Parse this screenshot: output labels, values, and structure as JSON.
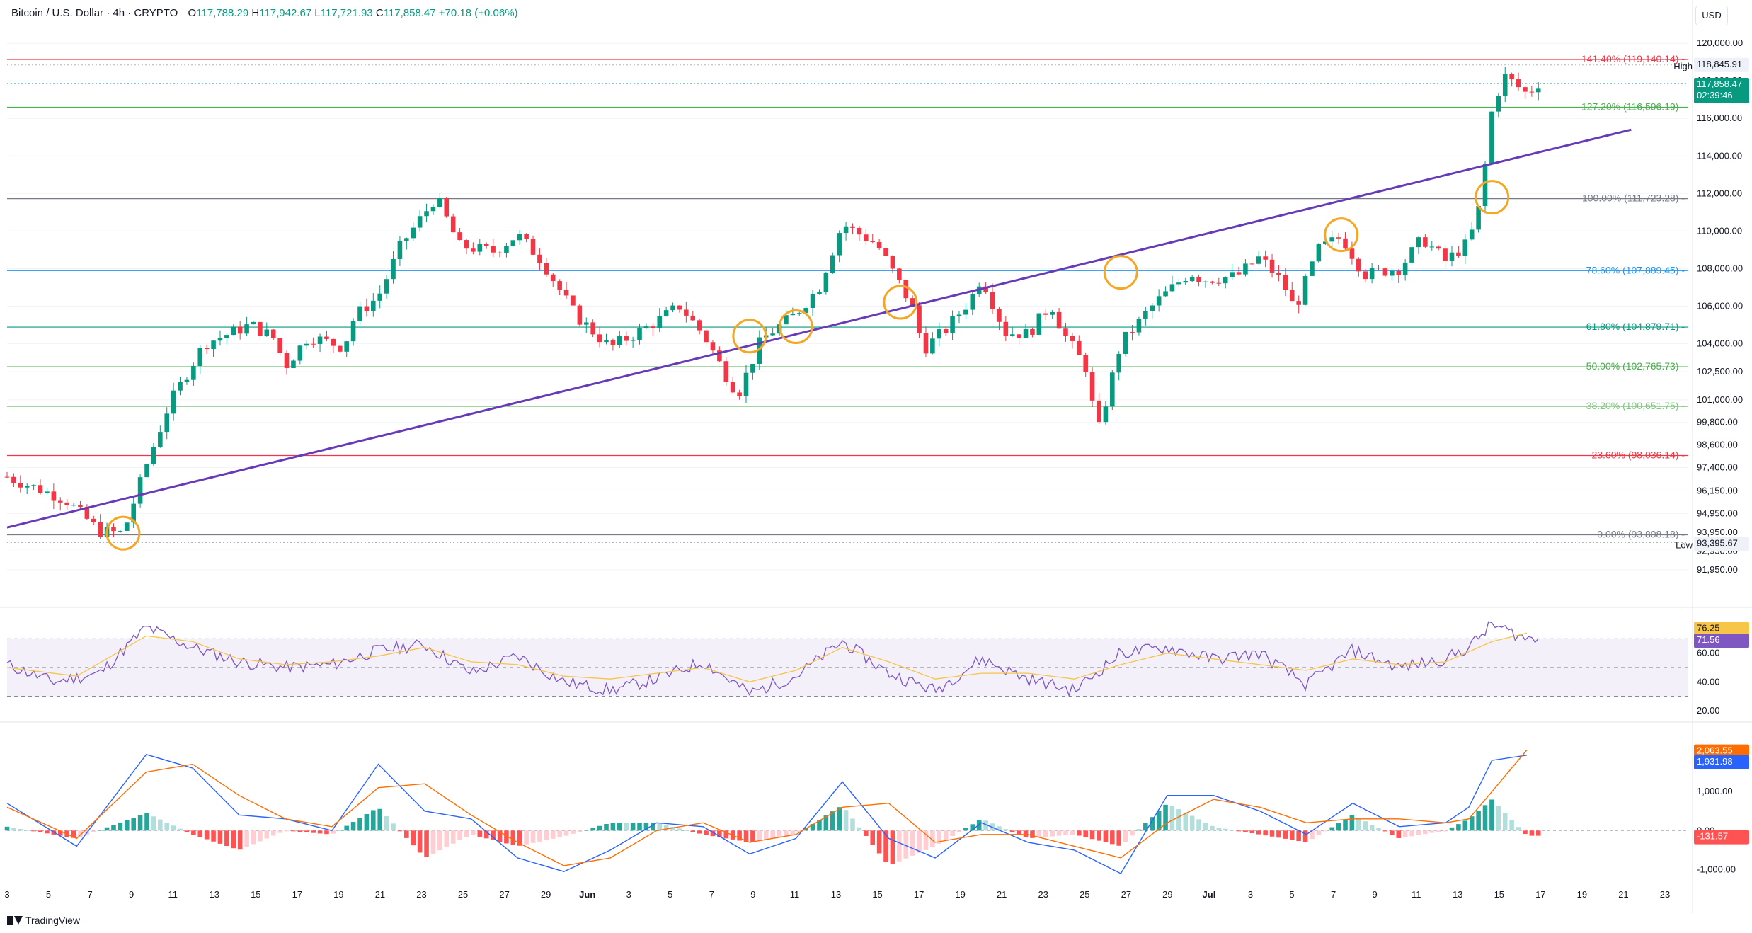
{
  "header": {
    "symbol": "Bitcoin / U.S. Dollar · 4h · CRYPTO",
    "o_label": "O",
    "o": "117,788.29",
    "h_label": "H",
    "h": "117,942.67",
    "l_label": "L",
    "l": "117,721.93",
    "c_label": "C",
    "c": "117,858.47",
    "change": "+70.18 (+0.06%)"
  },
  "currency_button": "USD",
  "brand": "TradingView",
  "colors": {
    "up": "#089981",
    "down": "#f23645",
    "trendline": "#673ab7",
    "circle": "#f5a623",
    "rsi": "#7e57c2",
    "rsi_ma": "#f7c548",
    "macd": "#2962ff",
    "signal": "#ff6d00"
  },
  "chart_data": [
    {
      "type": "candlestick",
      "timeframe": "4h",
      "yaxis_labels": [
        "120,000.00",
        "118,000.00",
        "116,000.00",
        "114,000.00",
        "112,000.00",
        "110,000.00",
        "108,000.00",
        "106,000.00",
        "104,000.00",
        "102,500.00",
        "101,000.00",
        "99,800.00",
        "98,600.00",
        "97,400.00",
        "96,150.00",
        "94,950.00",
        "93,950.00",
        "92,950.00",
        "91,950.00"
      ],
      "ylim": [
        91000,
        120800
      ],
      "xaxis_labels": [
        "3",
        "5",
        "7",
        "9",
        "11",
        "13",
        "15",
        "17",
        "19",
        "21",
        "23",
        "25",
        "27",
        "29",
        "Jun",
        "3",
        "5",
        "7",
        "9",
        "11",
        "13",
        "15",
        "17",
        "19",
        "21",
        "23",
        "25",
        "27",
        "29",
        "Jul",
        "3",
        "5",
        "7",
        "9",
        "11",
        "13",
        "15",
        "17",
        "19",
        "21",
        "23"
      ],
      "price_path": [
        [
          0,
          96900
        ],
        [
          5,
          95700
        ],
        [
          8,
          94000
        ],
        [
          10,
          93900
        ],
        [
          12,
          97500
        ],
        [
          14,
          100800
        ],
        [
          17,
          104000
        ],
        [
          21,
          105000
        ],
        [
          23,
          104300
        ],
        [
          24,
          102800
        ],
        [
          26,
          104400
        ],
        [
          29,
          103800
        ],
        [
          30,
          105500
        ],
        [
          32,
          106500
        ],
        [
          34,
          109300
        ],
        [
          37,
          111800
        ],
        [
          39,
          109200
        ],
        [
          42,
          108900
        ],
        [
          44,
          109800
        ],
        [
          46,
          108500
        ],
        [
          49,
          105500
        ],
        [
          52,
          103800
        ],
        [
          55,
          104800
        ],
        [
          58,
          106000
        ],
        [
          60,
          104500
        ],
        [
          62,
          102300
        ],
        [
          63,
          101300
        ],
        [
          65,
          104200
        ],
        [
          68,
          105600
        ],
        [
          70,
          107000
        ],
        [
          72,
          110400
        ],
        [
          73,
          110000
        ],
        [
          75,
          109300
        ],
        [
          78,
          106000
        ],
        [
          79,
          103700
        ],
        [
          81,
          104800
        ],
        [
          83,
          106300
        ],
        [
          84,
          107600
        ],
        [
          86,
          104600
        ],
        [
          88,
          104500
        ],
        [
          90,
          106100
        ],
        [
          91,
          104600
        ],
        [
          93,
          102700
        ],
        [
          94,
          99200
        ],
        [
          96,
          104000
        ],
        [
          99,
          106200
        ],
        [
          102,
          107800
        ],
        [
          103,
          107400
        ],
        [
          106,
          107600
        ],
        [
          108,
          108600
        ],
        [
          110,
          107200
        ],
        [
          111,
          105800
        ],
        [
          113,
          109000
        ],
        [
          115,
          109700
        ],
        [
          117,
          107700
        ],
        [
          120,
          108000
        ],
        [
          122,
          109600
        ],
        [
          124,
          108400
        ],
        [
          126,
          109400
        ],
        [
          127,
          111500
        ],
        [
          128,
          116400
        ],
        [
          129,
          118300
        ],
        [
          131,
          117300
        ],
        [
          132,
          117860
        ]
      ],
      "high": "118,845.91",
      "low": "93,395.67",
      "last_price": "117,858.47",
      "countdown": "02:39:46",
      "high_label": "High",
      "low_label": "Low",
      "fib_levels": [
        {
          "label": "141.40% (119,140.14)",
          "price": 119140.14,
          "color": "#f23645"
        },
        {
          "label": "127.20% (116,596.19)",
          "price": 116596.19,
          "color": "#4caf50"
        },
        {
          "label": "100.00% (111,723.28)",
          "price": 111723.28,
          "color": "#787b86"
        },
        {
          "label": "78.60% (107,889.45)",
          "price": 107889.45,
          "color": "#2196f3"
        },
        {
          "label": "61.80% (104,879.71)",
          "price": 104879.71,
          "color": "#089981"
        },
        {
          "label": "50.00% (102,765.73)",
          "price": 102765.73,
          "color": "#4caf50"
        },
        {
          "label": "38.20% (100,651.75)",
          "price": 100651.75,
          "color": "#81c784"
        },
        {
          "label": "23.60% (98,036.14)",
          "price": 98036.14,
          "color": "#f23645"
        },
        {
          "label": "0.00% (93,808.18)",
          "price": 93808.18,
          "color": "#787b86"
        }
      ],
      "trendline": [
        [
          0,
          94200
        ],
        [
          140,
          115400
        ]
      ],
      "touch_points": [
        [
          10,
          93900
        ],
        [
          64,
          104400
        ],
        [
          68,
          104900
        ],
        [
          77,
          106200
        ],
        [
          96,
          107800
        ],
        [
          115,
          109800
        ],
        [
          128,
          111800
        ]
      ]
    },
    {
      "type": "line",
      "name": "RSI",
      "yaxis_labels": [
        "60.00",
        "40.00",
        "20.00"
      ],
      "ylim": [
        17,
        82
      ],
      "bands": [
        70,
        50,
        30
      ],
      "rsi_path": [
        [
          0,
          52
        ],
        [
          4,
          40
        ],
        [
          8,
          46
        ],
        [
          12,
          78
        ],
        [
          16,
          64
        ],
        [
          20,
          54
        ],
        [
          24,
          50
        ],
        [
          28,
          52
        ],
        [
          32,
          62
        ],
        [
          36,
          66
        ],
        [
          40,
          46
        ],
        [
          44,
          58
        ],
        [
          48,
          40
        ],
        [
          52,
          34
        ],
        [
          56,
          42
        ],
        [
          60,
          54
        ],
        [
          64,
          32
        ],
        [
          68,
          44
        ],
        [
          72,
          68
        ],
        [
          76,
          46
        ],
        [
          80,
          34
        ],
        [
          84,
          56
        ],
        [
          88,
          42
        ],
        [
          92,
          34
        ],
        [
          96,
          60
        ],
        [
          100,
          64
        ],
        [
          104,
          56
        ],
        [
          108,
          60
        ],
        [
          112,
          38
        ],
        [
          116,
          62
        ],
        [
          120,
          50
        ],
        [
          124,
          56
        ],
        [
          126,
          64
        ],
        [
          128,
          80
        ],
        [
          131,
          70
        ]
      ],
      "ma_path": [
        [
          0,
          50
        ],
        [
          6,
          44
        ],
        [
          12,
          72
        ],
        [
          16,
          68
        ],
        [
          20,
          56
        ],
        [
          24,
          52
        ],
        [
          28,
          54
        ],
        [
          32,
          58
        ],
        [
          36,
          64
        ],
        [
          40,
          54
        ],
        [
          44,
          52
        ],
        [
          48,
          44
        ],
        [
          52,
          42
        ],
        [
          56,
          46
        ],
        [
          60,
          50
        ],
        [
          64,
          40
        ],
        [
          68,
          48
        ],
        [
          72,
          64
        ],
        [
          76,
          54
        ],
        [
          80,
          42
        ],
        [
          84,
          46
        ],
        [
          88,
          46
        ],
        [
          92,
          42
        ],
        [
          96,
          52
        ],
        [
          100,
          60
        ],
        [
          104,
          56
        ],
        [
          108,
          52
        ],
        [
          112,
          48
        ],
        [
          116,
          56
        ],
        [
          120,
          52
        ],
        [
          124,
          54
        ],
        [
          128,
          68
        ],
        [
          131,
          74
        ]
      ],
      "rsi_value": "71.56",
      "ma_value": "76.25"
    },
    {
      "type": "line",
      "name": "MACD",
      "yaxis_labels": [
        "1,000.00",
        "0.00",
        "-1,000.00"
      ],
      "ylim": [
        -1300,
        2600
      ],
      "macd_path": [
        [
          0,
          700
        ],
        [
          6,
          -400
        ],
        [
          12,
          1950
        ],
        [
          16,
          1600
        ],
        [
          20,
          400
        ],
        [
          24,
          300
        ],
        [
          28,
          0
        ],
        [
          32,
          1700
        ],
        [
          36,
          500
        ],
        [
          40,
          300
        ],
        [
          44,
          -700
        ],
        [
          48,
          -1050
        ],
        [
          52,
          -500
        ],
        [
          56,
          200
        ],
        [
          60,
          100
        ],
        [
          64,
          -600
        ],
        [
          68,
          -200
        ],
        [
          72,
          1250
        ],
        [
          76,
          -200
        ],
        [
          80,
          -700
        ],
        [
          84,
          200
        ],
        [
          88,
          -300
        ],
        [
          92,
          -500
        ],
        [
          96,
          -1100
        ],
        [
          100,
          900
        ],
        [
          104,
          900
        ],
        [
          108,
          500
        ],
        [
          112,
          -100
        ],
        [
          116,
          700
        ],
        [
          120,
          100
        ],
        [
          124,
          200
        ],
        [
          126,
          600
        ],
        [
          128,
          1800
        ],
        [
          131,
          1932
        ]
      ],
      "signal_path": [
        [
          0,
          600
        ],
        [
          6,
          -200
        ],
        [
          12,
          1500
        ],
        [
          16,
          1700
        ],
        [
          20,
          900
        ],
        [
          24,
          300
        ],
        [
          28,
          100
        ],
        [
          32,
          1100
        ],
        [
          36,
          1200
        ],
        [
          40,
          400
        ],
        [
          44,
          -300
        ],
        [
          48,
          -900
        ],
        [
          52,
          -700
        ],
        [
          56,
          0
        ],
        [
          60,
          200
        ],
        [
          64,
          -300
        ],
        [
          68,
          -100
        ],
        [
          72,
          600
        ],
        [
          76,
          700
        ],
        [
          80,
          -300
        ],
        [
          84,
          -100
        ],
        [
          88,
          -100
        ],
        [
          92,
          -400
        ],
        [
          96,
          -700
        ],
        [
          100,
          200
        ],
        [
          104,
          800
        ],
        [
          108,
          600
        ],
        [
          112,
          200
        ],
        [
          116,
          300
        ],
        [
          120,
          300
        ],
        [
          124,
          200
        ],
        [
          126,
          300
        ],
        [
          128,
          1000
        ],
        [
          131,
          2064
        ]
      ],
      "hist_value": "-131.57",
      "signal_value": "2,063.55",
      "macd_value": "1,931.98"
    }
  ]
}
